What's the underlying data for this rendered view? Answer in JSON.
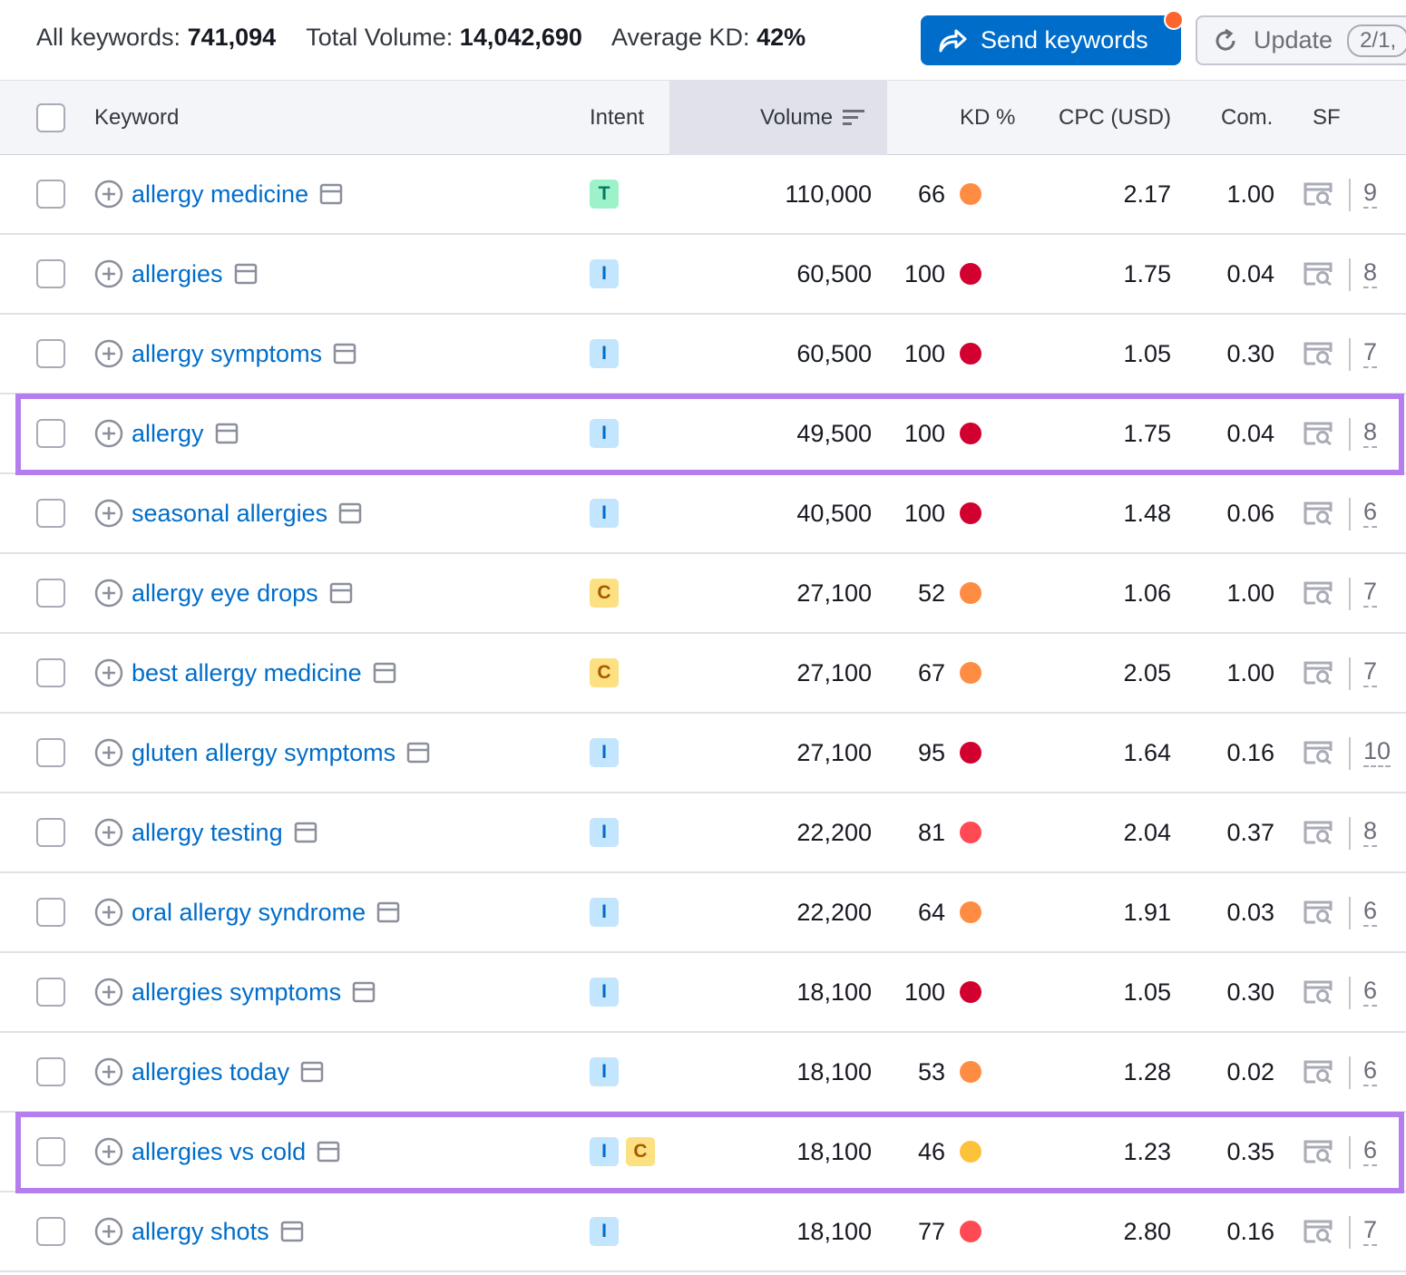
{
  "summary": {
    "all_keywords_label": "All keywords:",
    "all_keywords_value": "741,094",
    "total_volume_label": "Total Volume:",
    "total_volume_value": "14,042,690",
    "average_kd_label": "Average KD:",
    "average_kd_value": "42%"
  },
  "toolbar": {
    "send_label": "Send keywords",
    "update_label": "Update",
    "update_count": "2/1,"
  },
  "columns": {
    "keyword": "Keyword",
    "intent": "Intent",
    "volume": "Volume",
    "kd": "KD %",
    "cpc": "CPC (USD)",
    "com": "Com.",
    "sf": "SF"
  },
  "kd_colors": {
    "orange": "#ff8c43",
    "dark_red": "#d1002f",
    "red": "#ff4953",
    "yellow": "#fdc23c"
  },
  "rows": [
    {
      "keyword": "allergy medicine",
      "intents": [
        "T"
      ],
      "volume": "110,000",
      "kd": "66",
      "kd_color": "orange",
      "cpc": "2.17",
      "com": "1.00",
      "sf": "9"
    },
    {
      "keyword": "allergies",
      "intents": [
        "I"
      ],
      "volume": "60,500",
      "kd": "100",
      "kd_color": "dark_red",
      "cpc": "1.75",
      "com": "0.04",
      "sf": "8"
    },
    {
      "keyword": "allergy symptoms",
      "intents": [
        "I"
      ],
      "volume": "60,500",
      "kd": "100",
      "kd_color": "dark_red",
      "cpc": "1.05",
      "com": "0.30",
      "sf": "7"
    },
    {
      "keyword": "allergy",
      "intents": [
        "I"
      ],
      "volume": "49,500",
      "kd": "100",
      "kd_color": "dark_red",
      "cpc": "1.75",
      "com": "0.04",
      "sf": "8",
      "highlighted": true
    },
    {
      "keyword": "seasonal allergies",
      "intents": [
        "I"
      ],
      "volume": "40,500",
      "kd": "100",
      "kd_color": "dark_red",
      "cpc": "1.48",
      "com": "0.06",
      "sf": "6"
    },
    {
      "keyword": "allergy eye drops",
      "intents": [
        "C"
      ],
      "volume": "27,100",
      "kd": "52",
      "kd_color": "orange",
      "cpc": "1.06",
      "com": "1.00",
      "sf": "7"
    },
    {
      "keyword": "best allergy medicine",
      "intents": [
        "C"
      ],
      "volume": "27,100",
      "kd": "67",
      "kd_color": "orange",
      "cpc": "2.05",
      "com": "1.00",
      "sf": "7"
    },
    {
      "keyword": "gluten allergy symptoms",
      "intents": [
        "I"
      ],
      "volume": "27,100",
      "kd": "95",
      "kd_color": "dark_red",
      "cpc": "1.64",
      "com": "0.16",
      "sf": "10"
    },
    {
      "keyword": "allergy testing",
      "intents": [
        "I"
      ],
      "volume": "22,200",
      "kd": "81",
      "kd_color": "red",
      "cpc": "2.04",
      "com": "0.37",
      "sf": "8"
    },
    {
      "keyword": "oral allergy syndrome",
      "intents": [
        "I"
      ],
      "volume": "22,200",
      "kd": "64",
      "kd_color": "orange",
      "cpc": "1.91",
      "com": "0.03",
      "sf": "6"
    },
    {
      "keyword": "allergies symptoms",
      "intents": [
        "I"
      ],
      "volume": "18,100",
      "kd": "100",
      "kd_color": "dark_red",
      "cpc": "1.05",
      "com": "0.30",
      "sf": "6"
    },
    {
      "keyword": "allergies today",
      "intents": [
        "I"
      ],
      "volume": "18,100",
      "kd": "53",
      "kd_color": "orange",
      "cpc": "1.28",
      "com": "0.02",
      "sf": "6"
    },
    {
      "keyword": "allergies vs cold",
      "intents": [
        "I",
        "C"
      ],
      "volume": "18,100",
      "kd": "46",
      "kd_color": "yellow",
      "cpc": "1.23",
      "com": "0.35",
      "sf": "6",
      "highlighted": true
    },
    {
      "keyword": "allergy shots",
      "intents": [
        "I"
      ],
      "volume": "18,100",
      "kd": "77",
      "kd_color": "red",
      "cpc": "2.80",
      "com": "0.16",
      "sf": "7"
    }
  ]
}
